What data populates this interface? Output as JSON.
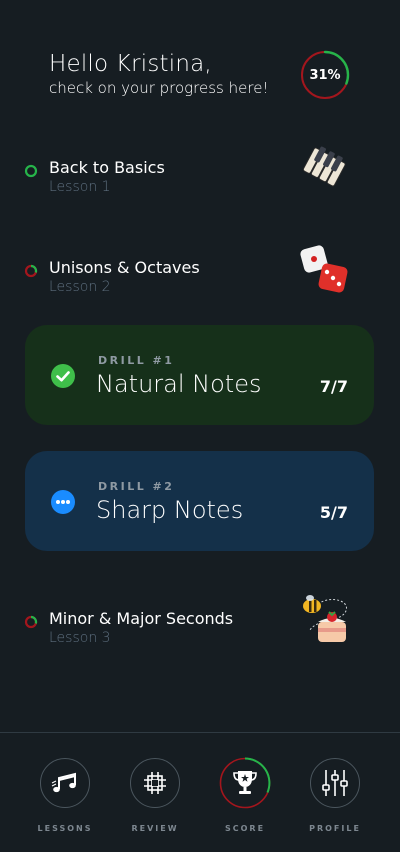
{
  "header": {
    "greeting": "Hello Kristina,",
    "subtitle": "check on your progress here!",
    "progress_label": "31%",
    "progress_value": 0.31
  },
  "lessons": [
    {
      "title": "Back to Basics",
      "subtitle": "Lesson 1",
      "status": "complete",
      "progress": 1.0,
      "art_icon": "piano-keys-icon"
    },
    {
      "title": "Unisons & Octaves",
      "subtitle": "Lesson 2",
      "status": "in-progress",
      "progress": 0.3,
      "art_icon": "dice-icon"
    },
    {
      "title": "Minor & Major Seconds",
      "subtitle": "Lesson 3",
      "status": "in-progress",
      "progress": 0.3,
      "art_icon": "bee-cake-icon"
    }
  ],
  "drills": [
    {
      "label": "DRILL #1",
      "name": "Natural Notes",
      "count": "7/7",
      "status_icon": "check-circle-icon",
      "bg": "#16301a",
      "icon_color": "#3fbf4a"
    },
    {
      "label": "DRILL #2",
      "name": "Sharp Notes",
      "count": "5/7",
      "status_icon": "more-dots-icon",
      "bg": "#143049",
      "icon_color": "#1a8cff"
    }
  ],
  "nav": [
    {
      "label": "LESSONS",
      "icon": "music-notes-icon"
    },
    {
      "label": "REVIEW",
      "icon": "grid-icon"
    },
    {
      "label": "SCORE",
      "icon": "trophy-icon",
      "active": true
    },
    {
      "label": "PROFILE",
      "icon": "sliders-icon"
    }
  ],
  "colors": {
    "background": "#161d22",
    "ring_green": "#26b44a",
    "ring_red": "#a3161d",
    "muted_text": "#5d6e7e"
  }
}
